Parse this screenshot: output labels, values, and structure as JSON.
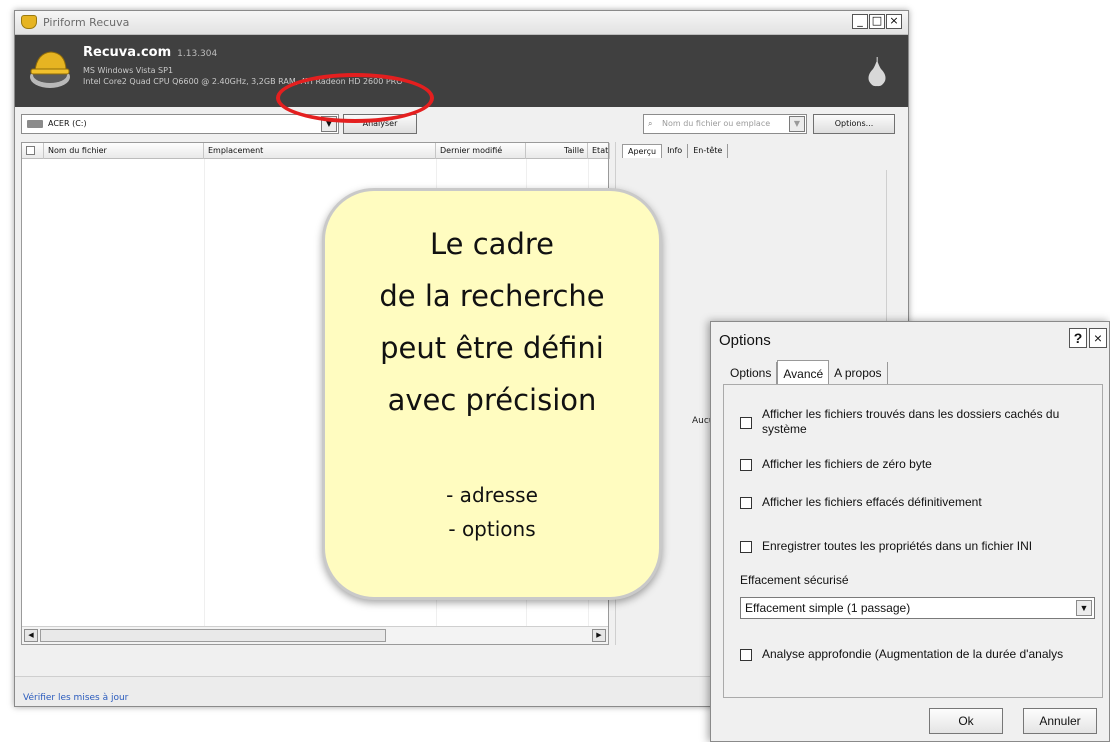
{
  "window": {
    "title": "Piriform Recuva",
    "controls": {
      "minimize": "_",
      "maximize": "□",
      "close": "×"
    }
  },
  "header": {
    "brand": "Recuva.com",
    "version": "1.13.304",
    "os_line": "MS Windows Vista SP1",
    "hw_line": "Intel Core2 Quad CPU Q6600 @ 2.40GHz, 3,2GB RAM, ATI Radeon HD 2600 PRO",
    "brand_color": "#e6b422",
    "band_color": "#404040"
  },
  "toolbar": {
    "drive": "ACER (C:)",
    "scan_label": "Analyser",
    "filter_placeholder": "Nom du fichier ou emplace",
    "options_label": "Options...",
    "highlight_color": "#e41f1f"
  },
  "table": {
    "columns": [
      "Nom du fichier",
      "Emplacement",
      "Dernier modifié",
      "Taille",
      "Etat"
    ]
  },
  "preview": {
    "tabs": [
      "Aperçu",
      "Info",
      "En-tête"
    ],
    "no_selection_text": "Aucu"
  },
  "status": {
    "update_link": "Vérifier les mises à jour"
  },
  "callout": {
    "lines": [
      "Le cadre",
      "de la recherche",
      "peut être défini",
      "avec précision"
    ],
    "bullets": [
      "- adresse",
      "- options"
    ],
    "background": "#fffcc0"
  },
  "dialog": {
    "title": "Options",
    "help": "?",
    "close": "×",
    "tabs": [
      "Options",
      "Avancé",
      "A propos"
    ],
    "active_tab": "Avancé",
    "checkboxes": [
      {
        "label": "Afficher les fichiers trouvés dans les dossiers cachés du système",
        "checked": false
      },
      {
        "label": "Afficher les fichiers de zéro byte",
        "checked": false
      },
      {
        "label": "Afficher les fichiers effacés définitivement",
        "checked": false
      },
      {
        "label": "Enregistrer toutes les propriétés dans un fichier INI",
        "checked": false
      }
    ],
    "secure_delete_label": "Effacement sécurisé",
    "secure_delete_value": "Effacement simple (1 passage)",
    "deep_scan": {
      "label": "Analyse approfondie (Augmentation de la durée d'analys",
      "checked": false
    },
    "ok_label": "Ok",
    "cancel_label": "Annuler"
  }
}
